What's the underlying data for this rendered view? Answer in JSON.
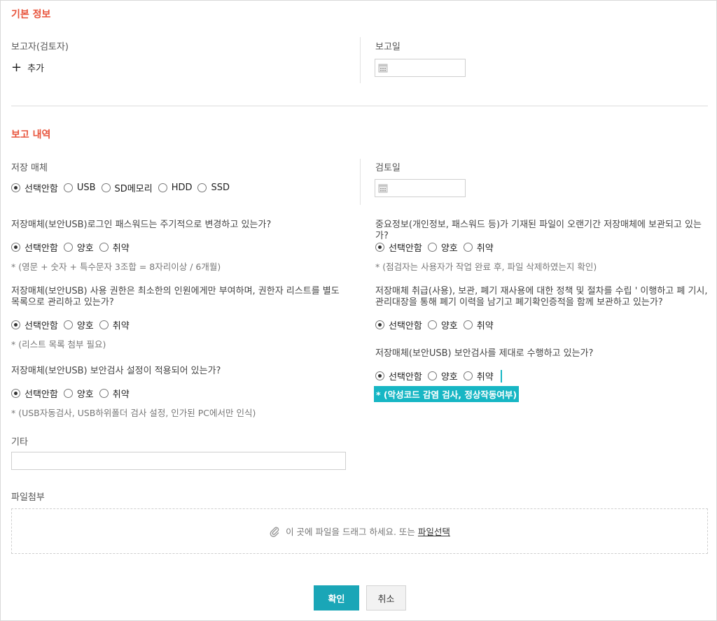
{
  "basic_info": {
    "title": "기본 정보",
    "reporter_label": "보고자(검토자)",
    "add_label": "추가",
    "report_date_label": "보고일"
  },
  "report_details": {
    "title": "보고 내역",
    "storage_media_label": "저장 매체",
    "storage_options": [
      "선택안함",
      "USB",
      "SD메모리",
      "HDD",
      "SSD"
    ],
    "review_date_label": "검토일"
  },
  "questions": {
    "q1": {
      "text": "저장매체(보안USB)로그인 패스워드는 주기적으로 변경하고 있는가?",
      "options": [
        "선택안함",
        "양호",
        "취약"
      ],
      "note": "* (영문 + 숫자 + 특수문자 3조합 = 8자리이상 / 6개월)"
    },
    "q2": {
      "text": "중요정보(개인정보, 패스워드 등)가 기재된 파일이 오랜기간 저장매체에 보관되고 있는가?",
      "options": [
        "선택안함",
        "양호",
        "취약"
      ],
      "note": "* (점검자는 사용자가 작업 완료 후, 파일 삭제하였는지 확인)"
    },
    "q3": {
      "text": "저장매체(보안USB) 사용 권한은 최소한의 인원에게만 부여하며, 권한자 리스트를 별도 목록으로 관리하고 있는가?",
      "options": [
        "선택안함",
        "양호",
        "취약"
      ],
      "note": "* (리스트 목록 첨부 필요)"
    },
    "q4": {
      "text": "저장매체 취급(사용), 보관, 폐기 재사용에 대한 정책 및 절차를 수립 ' 이행하고 폐 기시, 관리대장을 통해 폐기 이력을 남기고 폐기확인증적을 함께 보관하고 있는가?",
      "options": [
        "선택안함",
        "양호",
        "취약"
      ]
    },
    "q5": {
      "text": "저장매체(보안USB) 보안검사를 제대로 수행하고 있는가?",
      "options": [
        "선택안함",
        "양호",
        "취약"
      ],
      "note": "* (악성코드 감염 검사, 정상작동여부)"
    },
    "q6": {
      "text": "저장매체(보안USB) 보안검사 설정이 적용되어 있는가?",
      "options": [
        "선택안함",
        "양호",
        "취약"
      ],
      "note": "* (USB자동검사, USB하위폴더 검사 설정, 인가된 PC에서만 인식)"
    }
  },
  "etc": {
    "label": "기타",
    "value": ""
  },
  "attachment": {
    "label": "파일첨부",
    "drop_text": "이 곳에 파일을 드래그 하세요. 또는",
    "select_link": "파일선택"
  },
  "buttons": {
    "confirm": "확인",
    "cancel": "취소"
  },
  "colors": {
    "accent": "#1aa6b7",
    "section_title": "#e8543c",
    "highlight": "#17b6c4"
  },
  "icons": {
    "calendar": "calendar-icon",
    "paperclip": "paperclip-icon",
    "plus": "plus-icon"
  }
}
